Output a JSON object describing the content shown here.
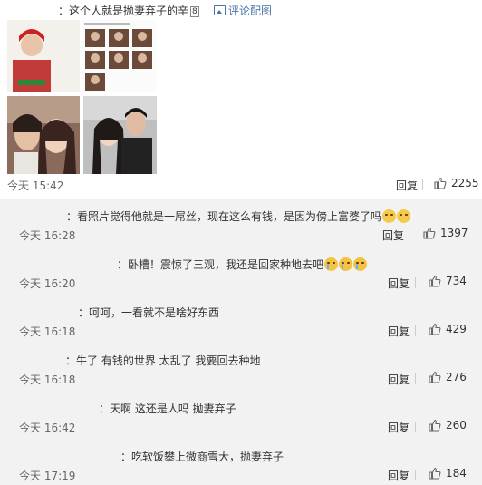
{
  "post": {
    "text": "：这个人就是抛妻弃子的辛",
    "count_badge": "8",
    "comment_pic_label": "评论配图",
    "time": "今天 15:42",
    "reply_label": "回复",
    "likes": "2255"
  },
  "comments": [
    {
      "text": "：看照片觉得他就是一屌丝，现在这么有钱，是因为傍上富婆了吗",
      "emoji": [
        "sweat-smile-emoji",
        "sweat-smile-emoji"
      ],
      "time": "今天 16:28",
      "reply_label": "回复",
      "likes": "1397"
    },
    {
      "text": "：卧槽！震惊了三观，我还是回家种地去吧",
      "emoji": [
        "crying-emoji",
        "crying-emoji",
        "crying-emoji"
      ],
      "time": "今天 16:20",
      "reply_label": "回复",
      "likes": "734"
    },
    {
      "text": "：呵呵，一看就不是啥好东西",
      "emoji": [],
      "time": "今天 16:18",
      "reply_label": "回复",
      "likes": "429"
    },
    {
      "text": "：牛了 有钱的世界 太乱了 我要回去种地",
      "emoji": [],
      "time": "今天 16:18",
      "reply_label": "回复",
      "likes": "276"
    },
    {
      "text": "：天啊  这还是人吗  抛妻弃子",
      "emoji": [],
      "time": "今天 16:42",
      "reply_label": "回复",
      "likes": "260"
    },
    {
      "text": "：吃软饭攀上微商雪大，抛妻弃子",
      "emoji": [],
      "time": "今天 17:19",
      "reply_label": "回复",
      "likes": "184"
    }
  ],
  "colors": {
    "link": "#4a73a8",
    "background": "#f2f2f2",
    "card": "#ffffff"
  }
}
